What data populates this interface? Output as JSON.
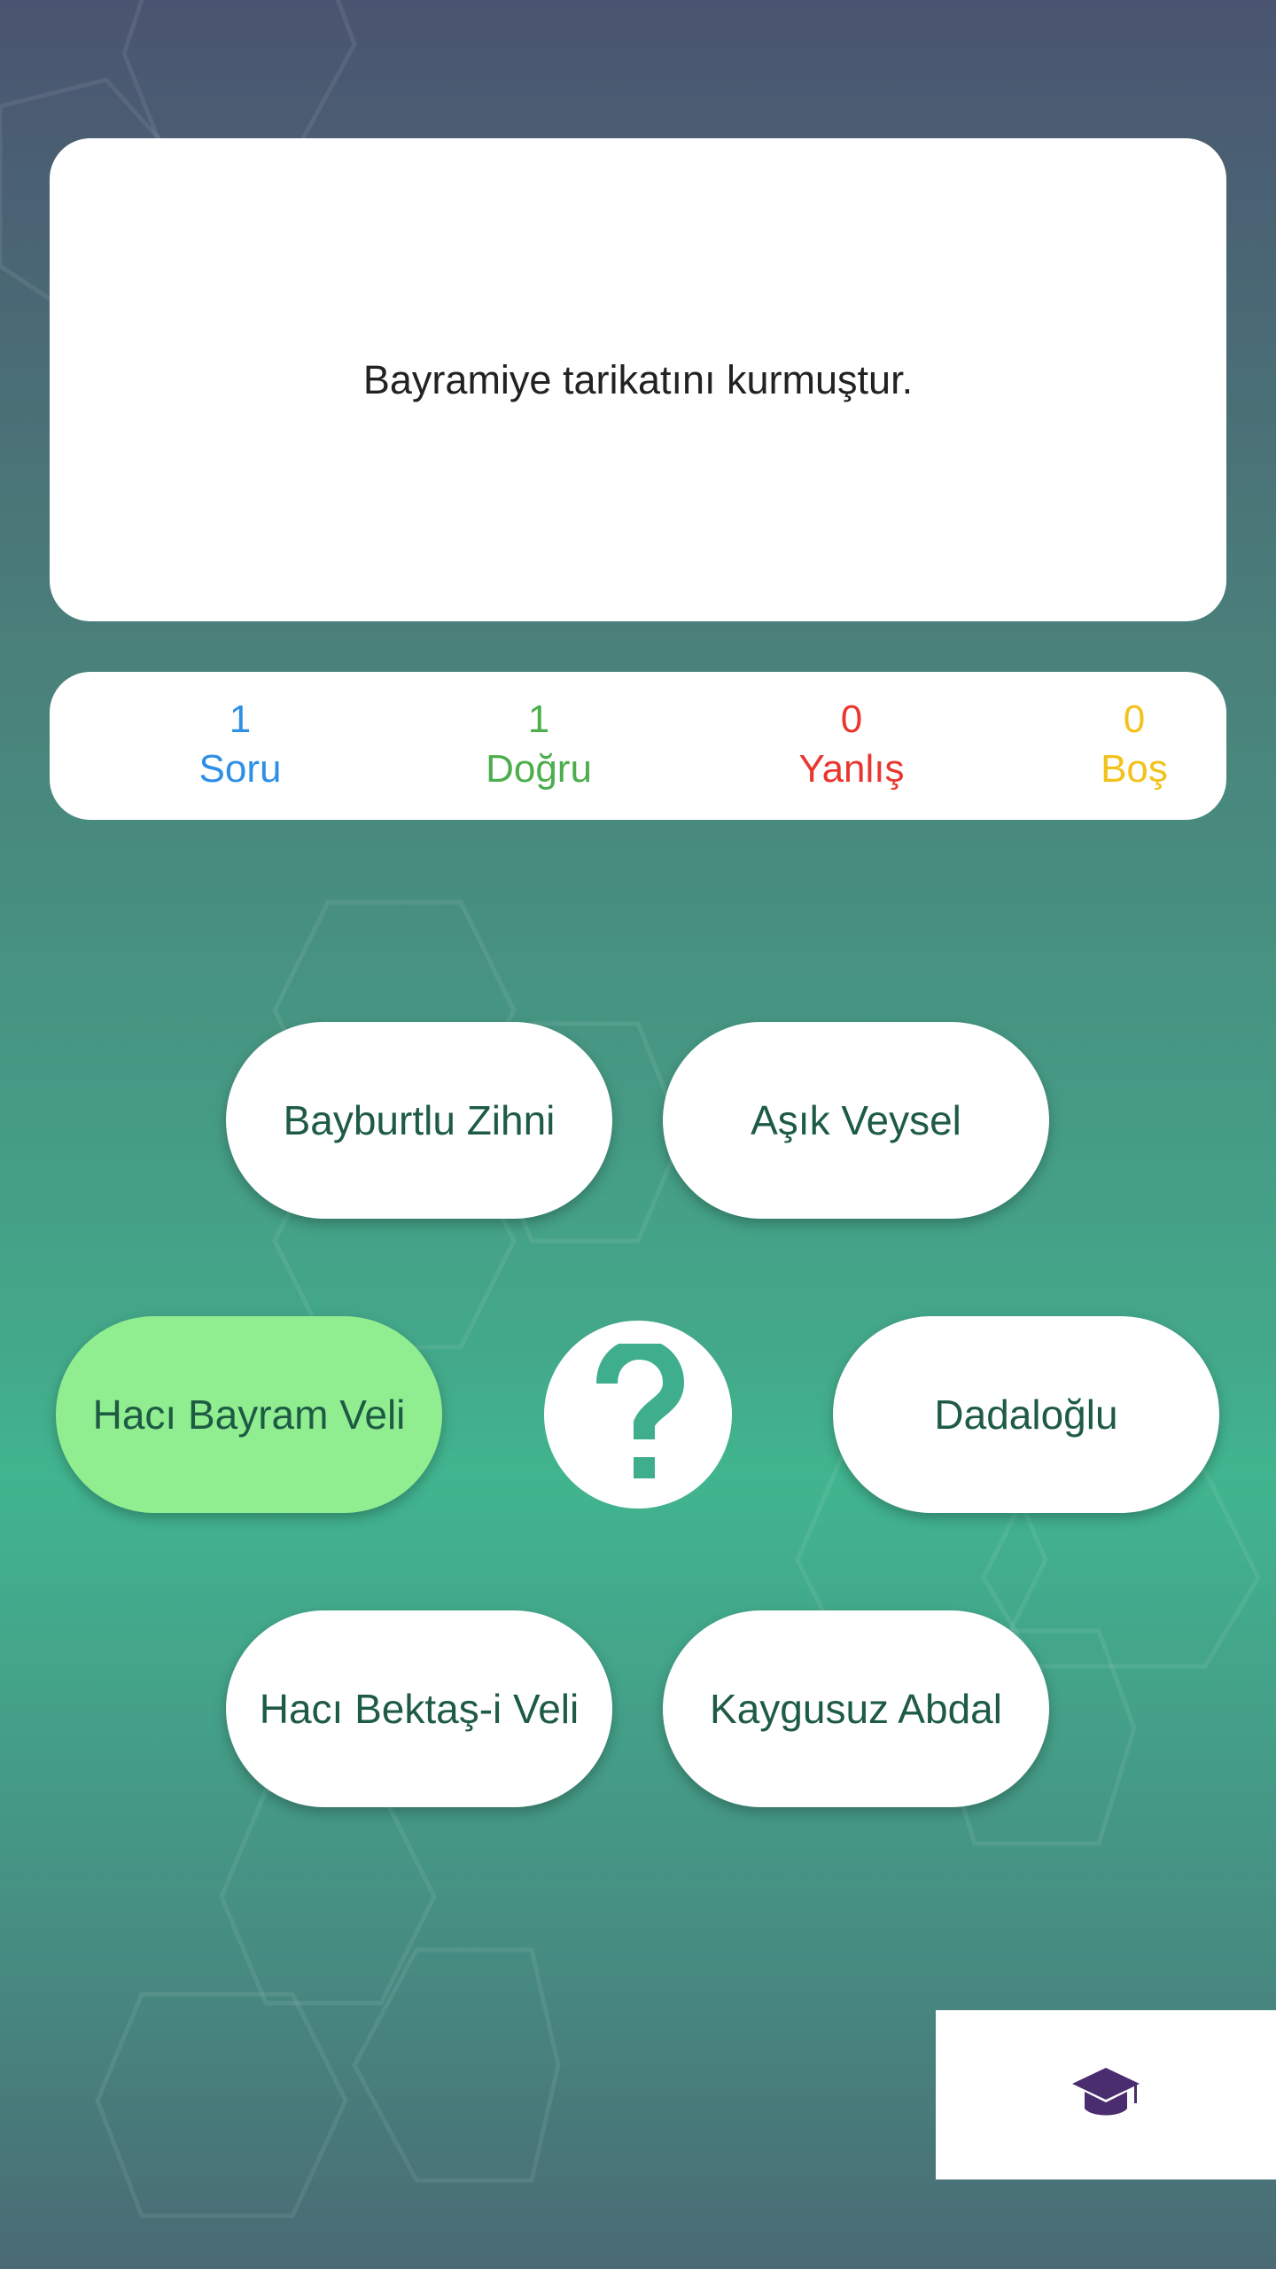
{
  "question": {
    "text": "Bayramiye tarikatını kurmuştur."
  },
  "stats": {
    "soru": {
      "value": "1",
      "label": "Soru",
      "color": "#2e8fe6"
    },
    "dogru": {
      "value": "1",
      "label": "Doğru",
      "color": "#4cae4c"
    },
    "yanlis": {
      "value": "0",
      "label": "Yanlış",
      "color": "#e8372e"
    },
    "bos": {
      "value": "0",
      "label": "Boş",
      "color": "#f2c21b"
    }
  },
  "answers": {
    "a1": {
      "label": "Bayburtlu Zihni"
    },
    "a2": {
      "label": "Aşık Veysel"
    },
    "a3": {
      "label": "Hacı Bayram Veli",
      "state": "correct"
    },
    "a4": {
      "label": "Dadaloğlu"
    },
    "a5": {
      "label": "Hacı Bektaş-i Veli"
    },
    "a6": {
      "label": "Kaygusuz Abdal"
    }
  },
  "icons": {
    "help": "question-mark-icon",
    "corner": "graduation-cap-icon"
  },
  "colors": {
    "answer_text": "#1e5b45",
    "correct_bg": "#90ee90",
    "question_mark": "#3fae8c",
    "cap": "#4a2d6e"
  }
}
